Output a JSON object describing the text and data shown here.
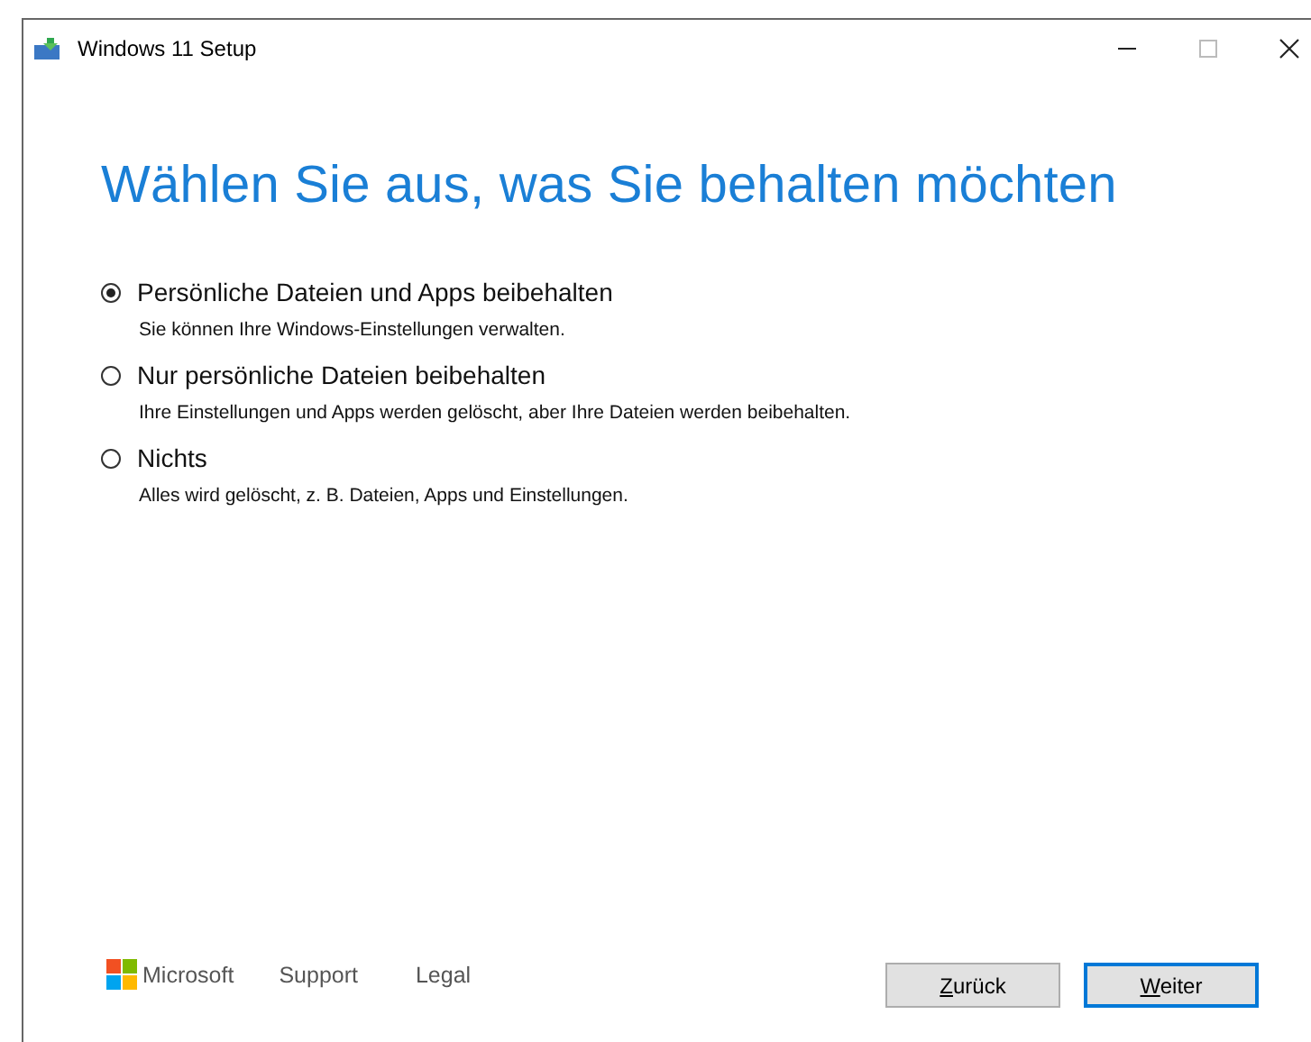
{
  "window": {
    "title": "Windows 11 Setup"
  },
  "heading": "Wählen Sie aus, was Sie behalten möchten",
  "options": [
    {
      "label": "Persönliche Dateien und Apps beibehalten",
      "description": "Sie können Ihre Windows-Einstellungen verwalten.",
      "selected": true
    },
    {
      "label": "Nur persönliche Dateien beibehalten",
      "description": "Ihre Einstellungen und Apps werden gelöscht, aber Ihre Dateien werden beibehalten.",
      "selected": false
    },
    {
      "label": "Nichts",
      "description": "Alles wird gelöscht, z. B. Dateien, Apps und Einstellungen.",
      "selected": false
    }
  ],
  "footer": {
    "brand": "Microsoft",
    "links": [
      "Support",
      "Legal"
    ]
  },
  "buttons": [
    {
      "mnemonic": "Z",
      "rest": "urück",
      "default": false
    },
    {
      "mnemonic": "W",
      "rest": "eiter",
      "default": true
    }
  ]
}
